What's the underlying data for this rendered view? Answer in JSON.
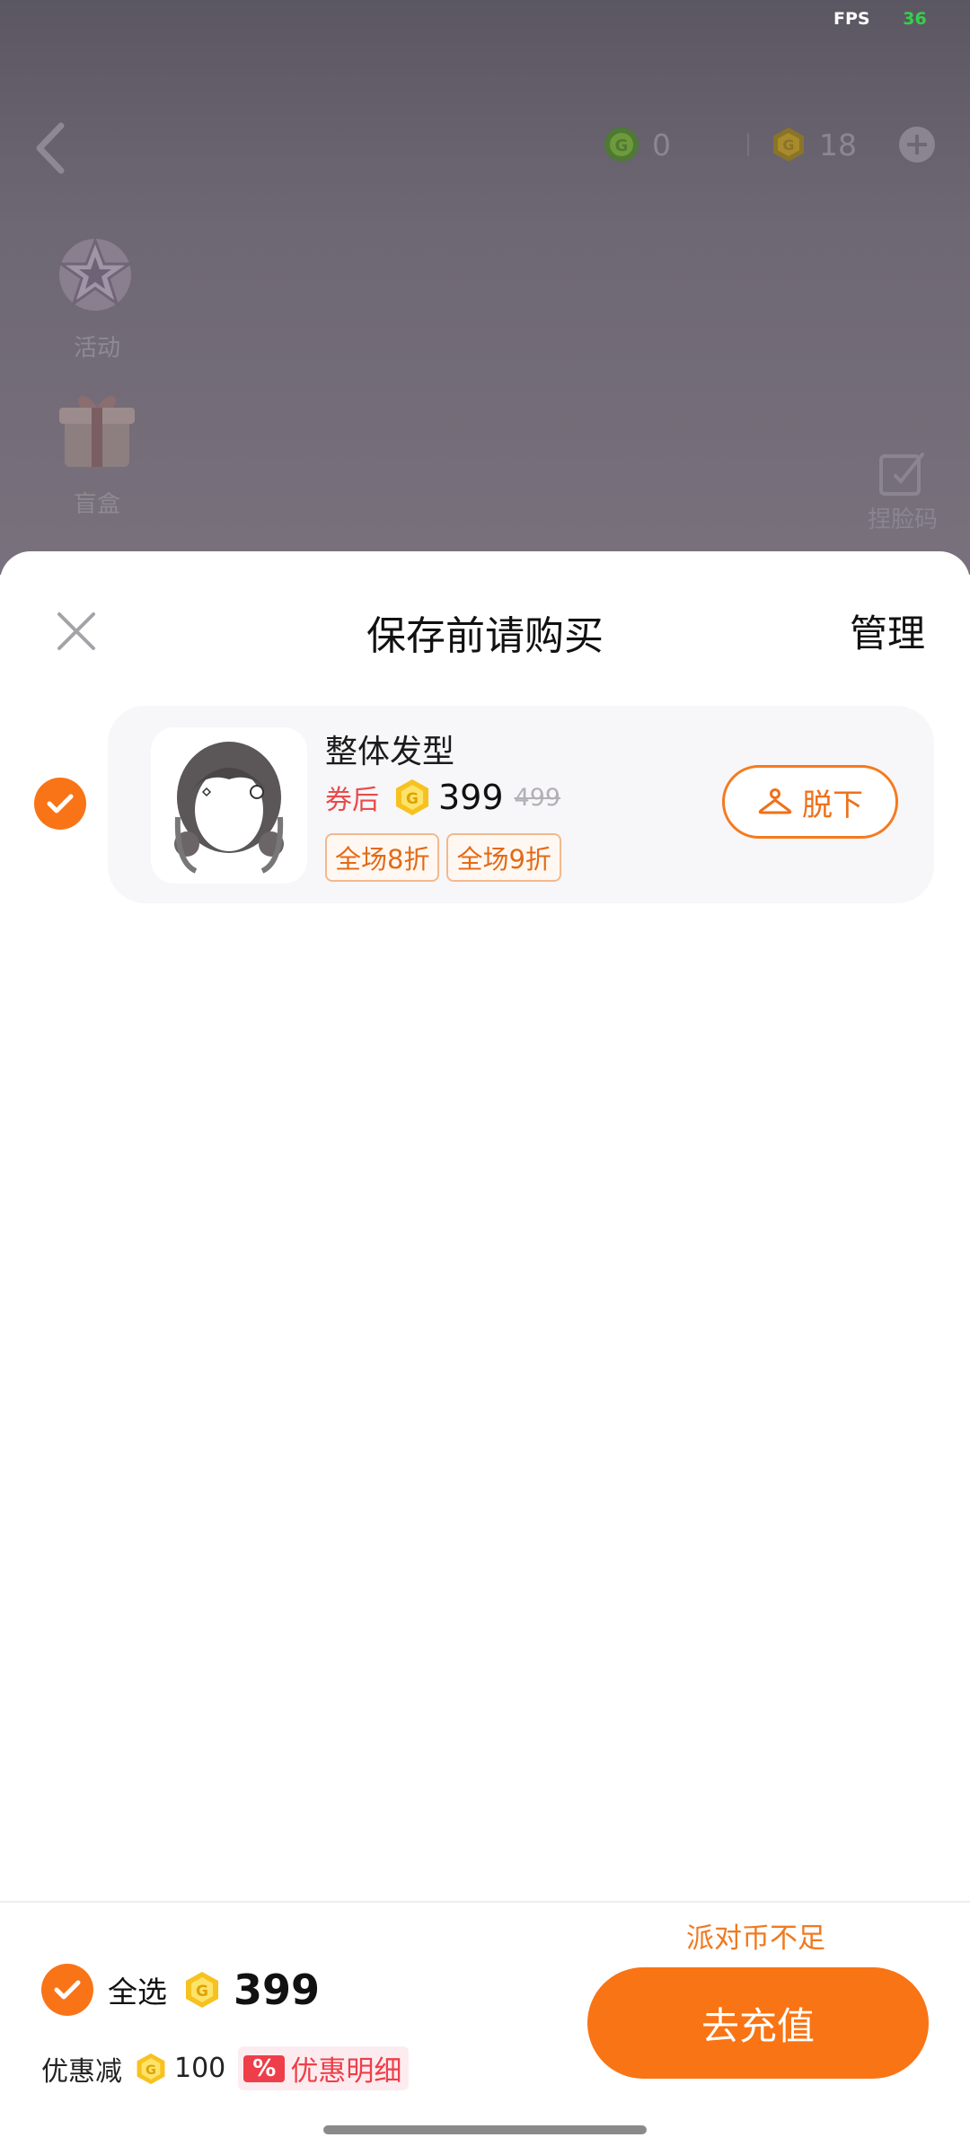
{
  "status": {
    "fps_label": "FPS",
    "fps_value": "36"
  },
  "topbar": {
    "green_currency": "0",
    "gold_currency": "18"
  },
  "side_menu": {
    "activity_label": "活动",
    "blindbox_label": "盲盒",
    "face_code_label": "捏脸码"
  },
  "sheet": {
    "title": "保存前请购买",
    "manage_label": "管理",
    "items": [
      {
        "name": "整体发型",
        "after_coupon_label": "券后",
        "price": "399",
        "original_price": "499",
        "tags": [
          "全场8折",
          "全场9折"
        ],
        "takeoff_label": "脱下"
      }
    ]
  },
  "footer": {
    "insufficient_notice": "派对币不足",
    "select_all_label": "全选",
    "total": "399",
    "discount_label": "优惠减",
    "discount_amount": "100",
    "discount_badge": "%",
    "discount_detail_label": "优惠明细",
    "recharge_label": "去充值"
  },
  "colors": {
    "accent": "#f97417",
    "discount_red": "#ee3e49",
    "overlay": "#6e6874"
  }
}
